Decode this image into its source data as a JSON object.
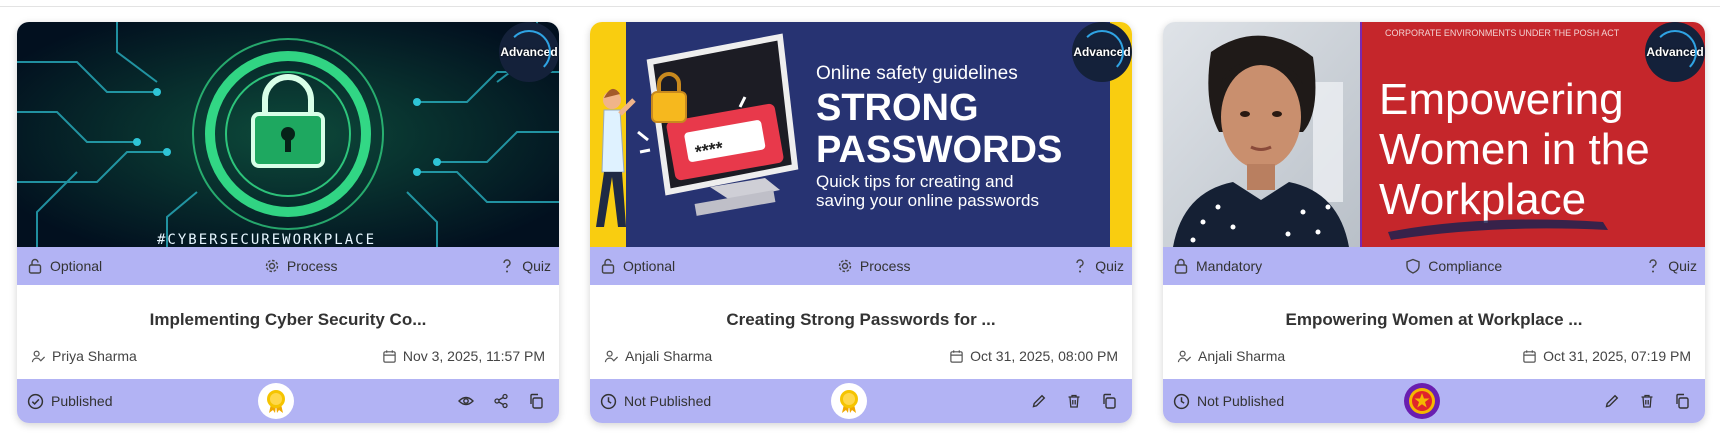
{
  "cards": [
    {
      "level": "Advanced",
      "tags": {
        "access": "Optional",
        "category": "Process",
        "type": "Quiz"
      },
      "title": "Implementing Cyber Security Co...",
      "author": "Priya Sharma",
      "date": "Nov 3, 2025, 11:57 PM",
      "status": "Published",
      "medal": "gold-medal-icon",
      "actions": [
        "eye-icon",
        "share-icon",
        "copy-icon"
      ],
      "thumbnail_text": [
        "#CYBERSECUREWORKPLACE"
      ]
    },
    {
      "level": "Advanced",
      "tags": {
        "access": "Optional",
        "category": "Process",
        "type": "Quiz"
      },
      "title": "Creating Strong Passwords for ...",
      "author": "Anjali Sharma",
      "date": "Oct 31, 2025, 08:00 PM",
      "status": "Not Published",
      "medal": "gold-medal-icon",
      "actions": [
        "edit-icon",
        "trash-icon",
        "copy-icon"
      ],
      "thumbnail_text": [
        "Online safety guidelines",
        "STRONG",
        "PASSWORDS",
        "Quick tips for creating and",
        "saving your online passwords",
        "****"
      ]
    },
    {
      "level": "Advanced",
      "tags": {
        "access": "Mandatory",
        "category": "Compliance",
        "type": "Quiz"
      },
      "title": "Empowering Women at Workplace ...",
      "author": "Anjali Sharma",
      "date": "Oct 31, 2025, 07:19 PM",
      "status": "Not Published",
      "medal": "red-star-medal-icon",
      "actions": [
        "edit-icon",
        "trash-icon",
        "copy-icon"
      ],
      "thumbnail_text": [
        "CORPORATE ENVIRONMENTS UNDER THE POSH ACT",
        "Empowering",
        "Women in the",
        "Workplace"
      ]
    }
  ],
  "colors": {
    "bar": "#b2b3f4",
    "gold": "#f5b800",
    "red_medal": "#e0242c",
    "purple_ring": "#6a1fb0"
  }
}
